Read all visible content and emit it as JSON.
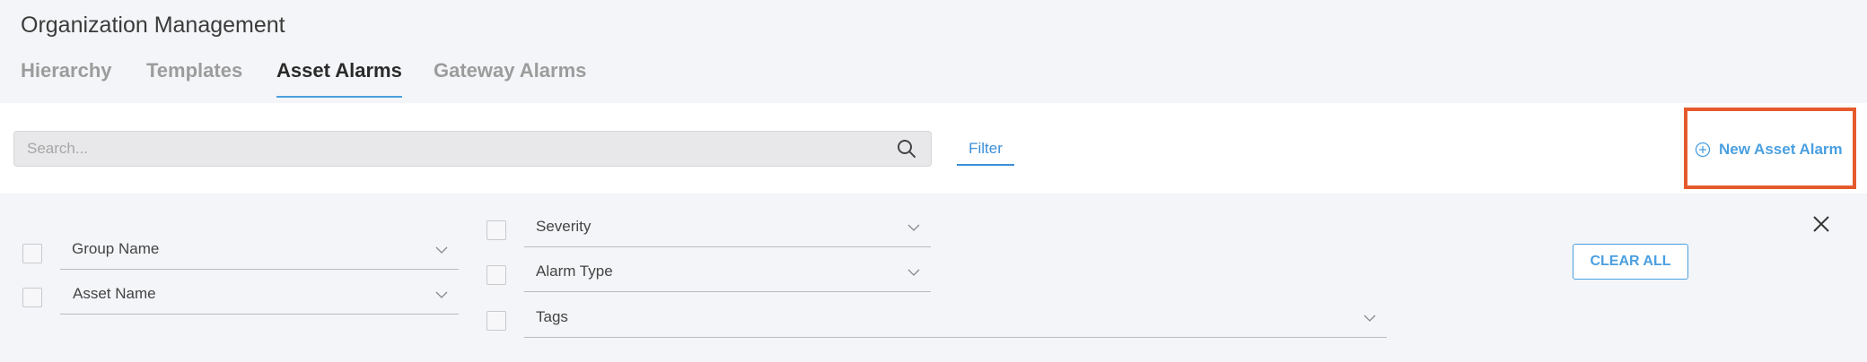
{
  "page": {
    "title": "Organization Management"
  },
  "tabs": [
    {
      "label": "Hierarchy",
      "active": false
    },
    {
      "label": "Templates",
      "active": false
    },
    {
      "label": "Asset Alarms",
      "active": true
    },
    {
      "label": "Gateway Alarms",
      "active": false
    }
  ],
  "toolbar": {
    "search_placeholder": "Search...",
    "filter_label": "Filter",
    "new_alarm_label": "New Asset Alarm",
    "highlight_color": "#e55a2b",
    "accent_color": "#4a9fe0"
  },
  "filters": {
    "group_name": "Group Name",
    "asset_name": "Asset Name",
    "severity": "Severity",
    "alarm_type": "Alarm Type",
    "tags": "Tags",
    "clear_all_label": "CLEAR ALL"
  },
  "icons": {
    "search": "search-icon",
    "add": "plus-circle-icon",
    "dropdown": "chevron-down-icon",
    "close": "close-icon"
  }
}
